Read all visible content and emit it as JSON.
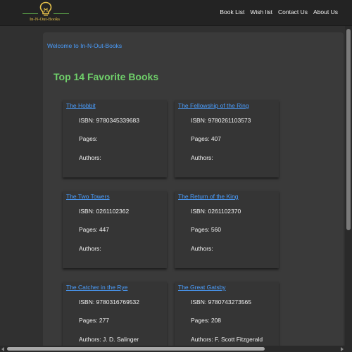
{
  "header": {
    "logo_text": "In-N-Out-Books",
    "nav": [
      {
        "label": "Book List"
      },
      {
        "label": "Wish list"
      },
      {
        "label": "Contact Us"
      },
      {
        "label": "About Us"
      }
    ]
  },
  "main": {
    "welcome": "Welcome to In-N-Out-Books",
    "heading": "Top 14 Favorite Books",
    "books": [
      {
        "title": "The Hobbit",
        "isbn": "ISBN: 9780345339683",
        "pages": "Pages:",
        "authors": "Authors:"
      },
      {
        "title": "The Fellowship of the Ring",
        "isbn": "ISBN: 9780261103573",
        "pages": "Pages: 407",
        "authors": "Authors:"
      },
      {
        "title": "The Two Towers",
        "isbn": "ISBN: 0261102362",
        "pages": "Pages: 447",
        "authors": "Authors:"
      },
      {
        "title": "The Return of the King",
        "isbn": "ISBN: 0261102370",
        "pages": "Pages: 560",
        "authors": "Authors:"
      },
      {
        "title": "The Catcher in the Rye",
        "isbn": "ISBN: 9780316769532",
        "pages": "Pages: 277",
        "authors": "Authors: J. D. Salinger"
      },
      {
        "title": "The Great Gatsby",
        "isbn": "ISBN: 9780743273565",
        "pages": "Pages: 208",
        "authors": "Authors: F. Scott Fitzgerald"
      }
    ]
  },
  "colors": {
    "accent_link": "#4a9eff",
    "heading_green": "#6fcf6a",
    "logo_gold": "#e6c14a"
  },
  "icons": {
    "logo": "lightbulb-icon"
  }
}
